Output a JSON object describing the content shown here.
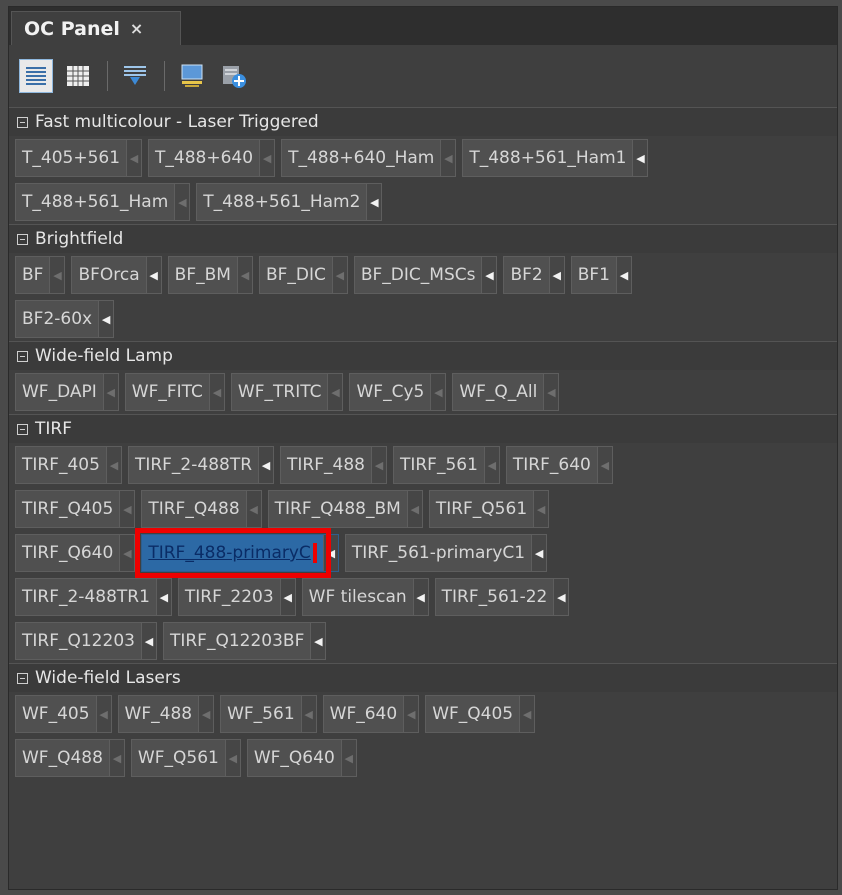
{
  "window": {
    "tab_title": "OC Panel",
    "tab_close": "×"
  },
  "toolbar": {
    "buttons": [
      {
        "icon": "list-view-icon",
        "active": true
      },
      {
        "icon": "grid-view-icon",
        "active": false
      },
      {
        "icon": "filter-icon",
        "active": false
      },
      {
        "icon": "monitor-config-icon",
        "active": false
      },
      {
        "icon": "add-configuration-icon",
        "active": false
      }
    ]
  },
  "colors": {
    "background": "#4a4a4a",
    "button": "#505050",
    "selected": "#2c69a5",
    "highlight": "#ee0000"
  },
  "sections": [
    {
      "title": "Fast multicolour - Laser Triggered",
      "rows": [
        [
          {
            "label": "T_405+561",
            "arrow": "dim"
          },
          {
            "label": "T_488+640",
            "arrow": "dim"
          },
          {
            "label": "T_488+640_Ham",
            "arrow": "dim"
          },
          {
            "label": "T_488+561_Ham1",
            "arrow": "bright"
          }
        ],
        [
          {
            "label": "T_488+561_Ham",
            "arrow": "dim"
          },
          {
            "label": "T_488+561_Ham2",
            "arrow": "bright"
          }
        ]
      ]
    },
    {
      "title": "Brightfield",
      "rows": [
        [
          {
            "label": "BF",
            "arrow": "dim"
          },
          {
            "label": "BFOrca",
            "arrow": "bright"
          },
          {
            "label": "BF_BM",
            "arrow": "dim"
          },
          {
            "label": "BF_DIC",
            "arrow": "dim"
          },
          {
            "label": "BF_DIC_MSCs",
            "arrow": "bright"
          },
          {
            "label": "BF2",
            "arrow": "bright"
          },
          {
            "label": "BF1",
            "arrow": "bright"
          }
        ],
        [
          {
            "label": "BF2-60x",
            "arrow": "bright"
          }
        ]
      ]
    },
    {
      "title": "Wide-field Lamp",
      "rows": [
        [
          {
            "label": "WF_DAPI",
            "arrow": "dim"
          },
          {
            "label": "WF_FITC",
            "arrow": "dim"
          },
          {
            "label": "WF_TRITC",
            "arrow": "dim"
          },
          {
            "label": "WF_Cy5",
            "arrow": "dim"
          },
          {
            "label": "WF_Q_All",
            "arrow": "dim"
          }
        ]
      ]
    },
    {
      "title": "TIRF",
      "rows": [
        [
          {
            "label": "TIRF_405",
            "arrow": "dim"
          },
          {
            "label": "TIRF_2-488TR",
            "arrow": "bright"
          },
          {
            "label": "TIRF_488",
            "arrow": "dim"
          },
          {
            "label": "TIRF_561",
            "arrow": "dim"
          },
          {
            "label": "TIRF_640",
            "arrow": "dim"
          }
        ],
        [
          {
            "label": "TIRF_Q405",
            "arrow": "dim"
          },
          {
            "label": "TIRF_Q488",
            "arrow": "dim"
          },
          {
            "label": "TIRF_Q488_BM",
            "arrow": "dim"
          },
          {
            "label": "TIRF_Q561",
            "arrow": "dim"
          }
        ],
        [
          {
            "label": "TIRF_Q640",
            "arrow": "dim"
          },
          {
            "label": "TIRF_488-primaryC",
            "arrow": "bright",
            "selected": true
          },
          {
            "label": "TIRF_561-primaryC1",
            "arrow": "bright"
          }
        ],
        [
          {
            "label": "TIRF_2-488TR1",
            "arrow": "bright"
          },
          {
            "label": "TIRF_2203",
            "arrow": "bright"
          },
          {
            "label": "WF tilescan",
            "arrow": "bright"
          },
          {
            "label": "TIRF_561-22",
            "arrow": "bright"
          }
        ],
        [
          {
            "label": "TIRF_Q12203",
            "arrow": "bright"
          },
          {
            "label": "TIRF_Q12203BF",
            "arrow": "bright"
          }
        ]
      ]
    },
    {
      "title": "Wide-field Lasers",
      "rows": [
        [
          {
            "label": "WF_405",
            "arrow": "dim"
          },
          {
            "label": "WF_488",
            "arrow": "dim"
          },
          {
            "label": "WF_561",
            "arrow": "dim"
          },
          {
            "label": "WF_640",
            "arrow": "dim"
          },
          {
            "label": "WF_Q405",
            "arrow": "dim"
          }
        ],
        [
          {
            "label": "WF_Q488",
            "arrow": "dim"
          },
          {
            "label": "WF_Q561",
            "arrow": "dim"
          },
          {
            "label": "WF_Q640",
            "arrow": "dim"
          }
        ]
      ]
    }
  ]
}
